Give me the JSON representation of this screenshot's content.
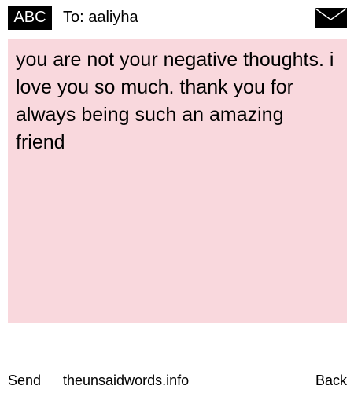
{
  "header": {
    "input_mode": "ABC",
    "recipient_label": "To: aaliyha",
    "icon": "envelope-icon"
  },
  "message": {
    "text": "you are not your negative thoughts. i love you so much. thank you for always being such an amazing friend",
    "background_color": "#f9d8dd"
  },
  "footer": {
    "send_label": "Send",
    "site_label": "theunsaidwords.info",
    "back_label": "Back"
  }
}
